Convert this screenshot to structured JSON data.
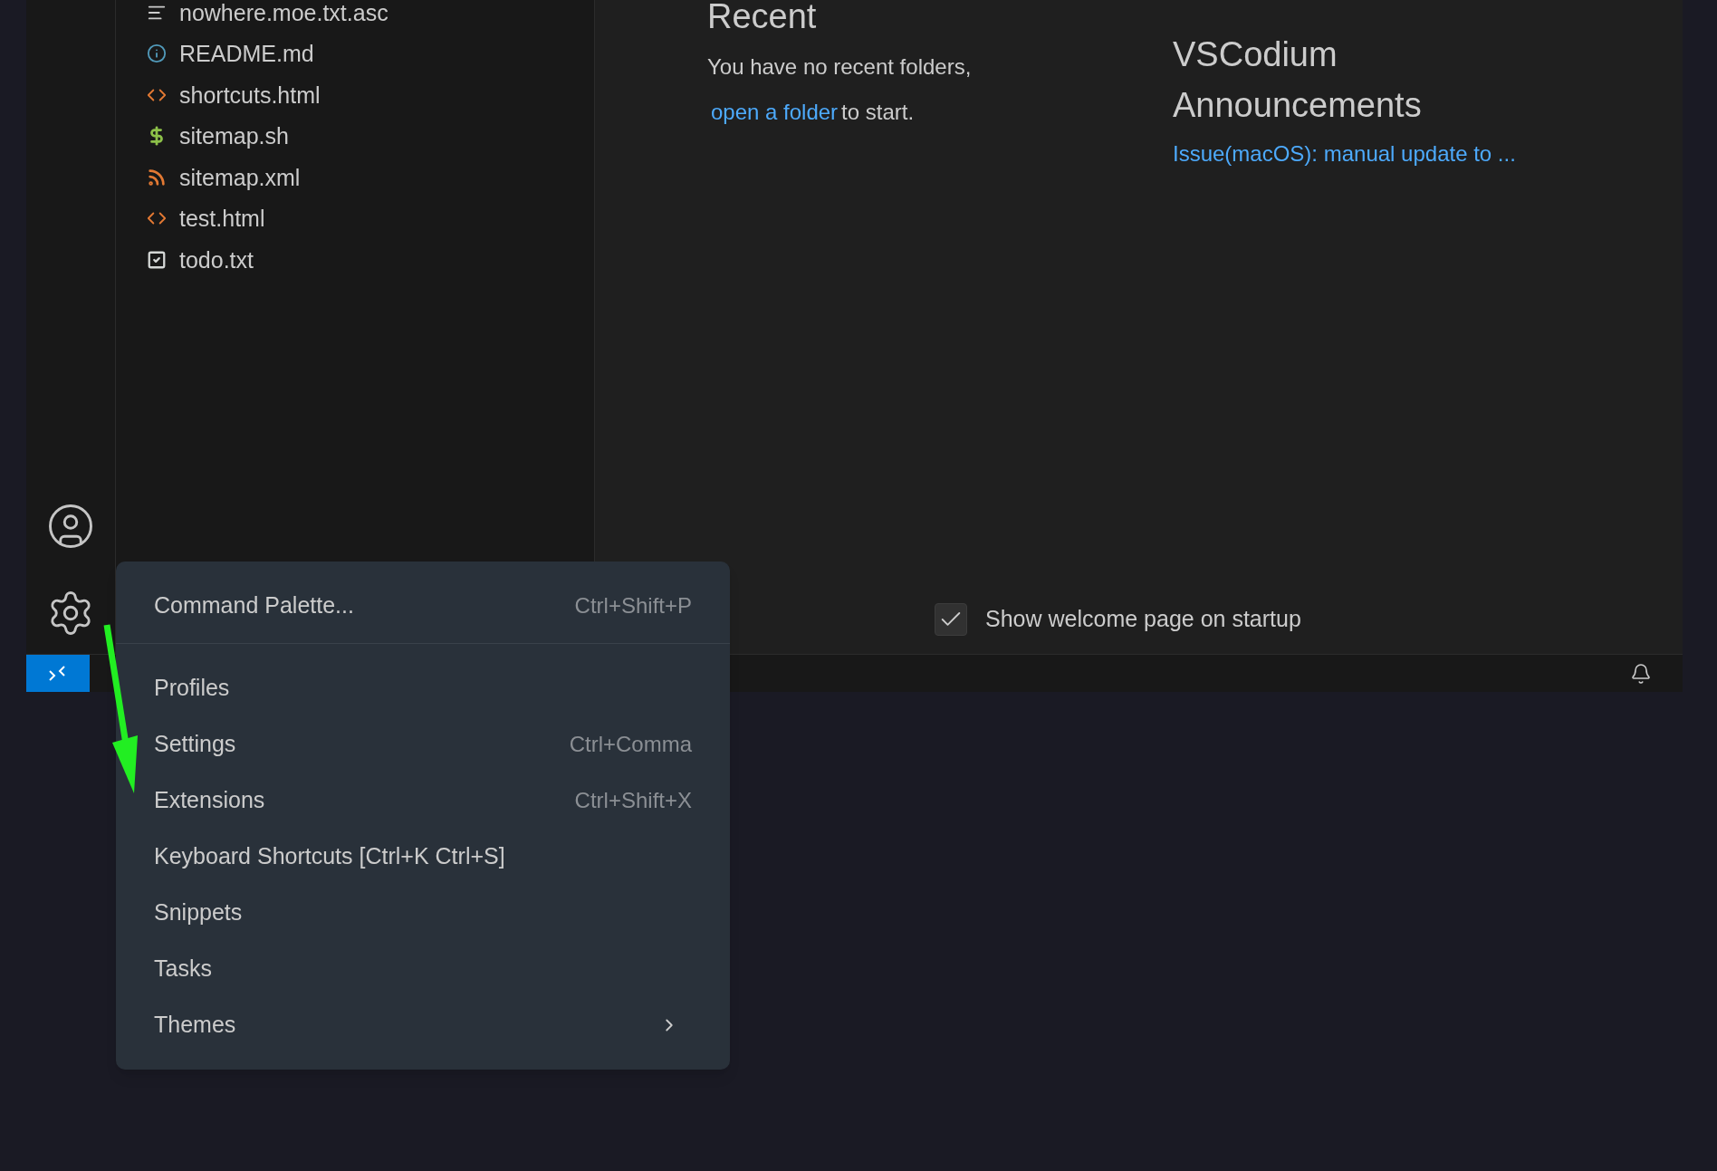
{
  "explorer": {
    "files": [
      {
        "name": "nowhere.moe.txt.asc",
        "kind": "text"
      },
      {
        "name": "README.md",
        "kind": "info"
      },
      {
        "name": "shortcuts.html",
        "kind": "html"
      },
      {
        "name": "sitemap.sh",
        "kind": "shell"
      },
      {
        "name": "sitemap.xml",
        "kind": "feed"
      },
      {
        "name": "test.html",
        "kind": "html"
      },
      {
        "name": "todo.txt",
        "kind": "todo"
      }
    ]
  },
  "welcome": {
    "recent": {
      "title": "Recent",
      "message": "You have no recent folders,",
      "link": "open a folder",
      "link_suffix": "to start."
    },
    "announcements": {
      "title_lines": [
        "VSCodium",
        "Announcements"
      ],
      "link": "Issue(macOS): manual update to ..."
    },
    "show_on_startup": {
      "label": "Show welcome page on startup",
      "checked": true
    }
  },
  "menu": {
    "sections": [
      {
        "items": [
          {
            "label": "Command Palette...",
            "shortcut": "Ctrl+Shift+P",
            "submenu": false
          }
        ]
      },
      {
        "items": [
          {
            "label": "Profiles",
            "submenu": false
          },
          {
            "label": "Settings",
            "shortcut": "Ctrl+Comma",
            "submenu": false
          },
          {
            "label": "Extensions",
            "shortcut": "Ctrl+Shift+X",
            "submenu": false
          },
          {
            "label": "Keyboard Shortcuts [Ctrl+K Ctrl+S]",
            "submenu": false
          },
          {
            "label": "Snippets",
            "submenu": false
          },
          {
            "label": "Tasks",
            "submenu": false
          },
          {
            "label": "Themes",
            "submenu": true
          }
        ]
      }
    ]
  }
}
